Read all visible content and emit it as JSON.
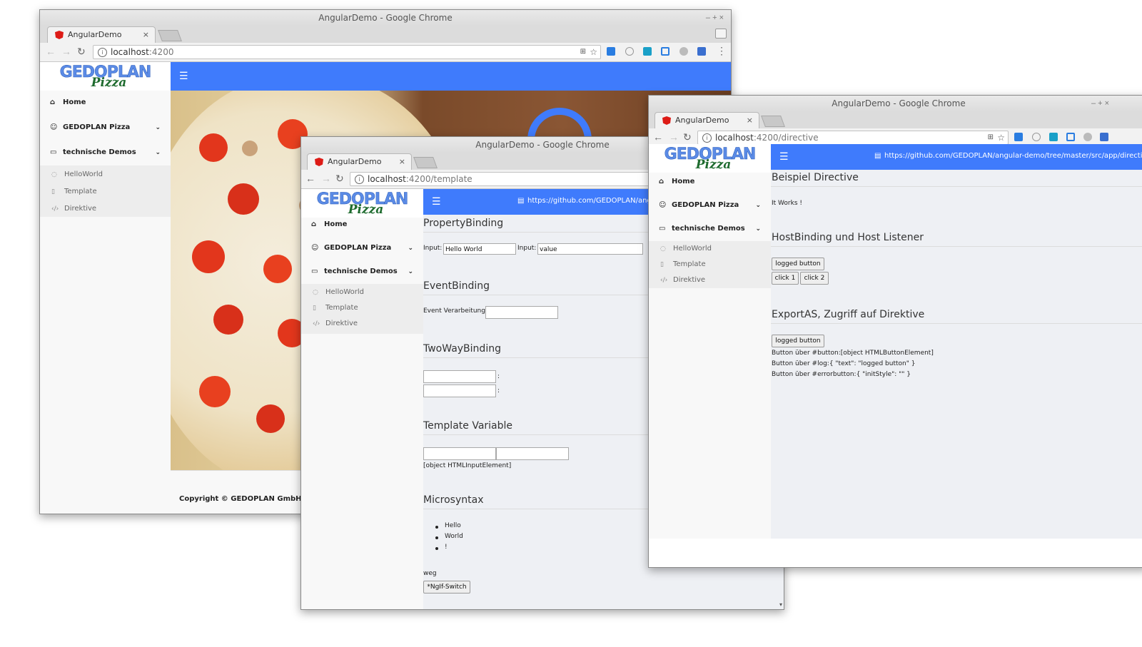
{
  "colors": {
    "accent": "#3f7bfc",
    "sidebar": "#f8f8f8",
    "main_bg": "#eef0f4"
  },
  "shared": {
    "window_title": "AngularDemo - Google Chrome",
    "tab_title": "AngularDemo",
    "tab_close": "×",
    "host": "localhost",
    "logo_top": "GEDOPLAN",
    "logo_bottom": "Pizza",
    "nav_home": "Home",
    "nav_pizza": "GEDOPLAN Pizza",
    "nav_demos": "technische Demos",
    "sub_hello": "HelloWorld",
    "sub_template": "Template",
    "sub_directive": "Direktive",
    "win_controls": "–  +  ×"
  },
  "window1": {
    "url_port": ":4200",
    "footer": "Copyright © GEDOPLAN GmbH"
  },
  "window2": {
    "url_port": ":4200/template",
    "github": "https://github.com/GEDOPLAN/angular-demo/tree/master/src/app/template",
    "sections": {
      "property": "PropertyBinding",
      "event": "EventBinding",
      "twoway": "TwoWayBinding",
      "templatevar": "Template Variable",
      "micro": "Microsyntax"
    },
    "input_label": "Input:",
    "input1_value": "Hello World",
    "input2_value": "value",
    "event_label": "Event Verarbeitung:",
    "colon": ":",
    "templatevar_output": "[object HTMLInputElement]",
    "list": [
      "Hello",
      "World",
      "!"
    ],
    "weg": "weg",
    "switch_button": "*NgIf-Switch"
  },
  "window3": {
    "url_port": ":4200/directive",
    "github": "https://github.com/GEDOPLAN/angular-demo/tree/master/src/app/directive",
    "h_directive": "Beispiel Directive",
    "it_works": "It Works !",
    "h_host": "HostBinding und Host Listener",
    "logged_button": "logged button",
    "click1": "click 1",
    "click2": "click 2",
    "h_export": "ExportAS, Zugriff auf Direktive",
    "line1": "Button über #button:[object HTMLButtonElement]",
    "line2": "Button über #log:{ \"text\": \"logged button\" }",
    "line3": "Button über #errorbutton:{ \"initStyle\": \"\" }"
  }
}
